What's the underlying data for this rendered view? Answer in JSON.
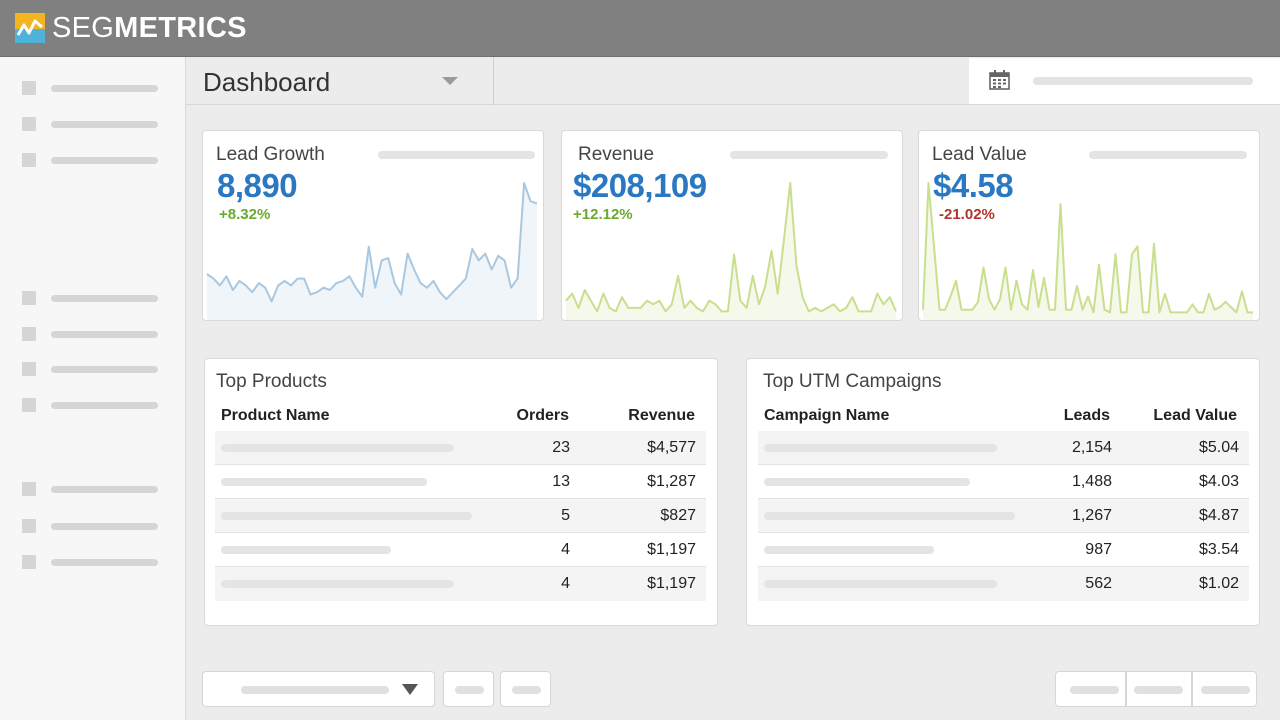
{
  "brand": {
    "name_light": "SEG",
    "name_bold": "METRICS",
    "colors": {
      "header": "#808080",
      "accent": "#2a78c2",
      "positive": "#6aaa2c",
      "negative": "#b5332e",
      "logo_yellow": "#f2b51f",
      "logo_blue": "#4fb3d9"
    }
  },
  "sidebar": {
    "icon": "placeholder-square-icon",
    "groups": [
      {
        "items": [
          {
            "label": ""
          },
          {
            "label": ""
          },
          {
            "label": ""
          }
        ]
      },
      {
        "items": [
          {
            "label": ""
          },
          {
            "label": ""
          },
          {
            "label": ""
          },
          {
            "label": ""
          }
        ]
      },
      {
        "items": [
          {
            "label": ""
          },
          {
            "label": ""
          },
          {
            "label": ""
          }
        ]
      }
    ]
  },
  "header": {
    "title": "Dashboard",
    "title_dropdown_icon": "caret-down-icon",
    "date_icon": "calendar-icon"
  },
  "metrics": [
    {
      "label": "Lead Growth",
      "value": "8,890",
      "change": "+8.32%",
      "trend": "positive",
      "chart_color": "#a9c8e0",
      "series": [
        18,
        16,
        13,
        17,
        11,
        15,
        13,
        10,
        14,
        12,
        6,
        13,
        15,
        13,
        16,
        16,
        9,
        10,
        12,
        11,
        14,
        15,
        17,
        12,
        8,
        30,
        12,
        24,
        25,
        14,
        9,
        27,
        20,
        14,
        12,
        15,
        10,
        7,
        10,
        13,
        16,
        29,
        24,
        27,
        20,
        26,
        24,
        12,
        16,
        58,
        50,
        49
      ]
    },
    {
      "label": "Revenue",
      "value": "$208,109",
      "change": "+12.12%",
      "trend": "positive",
      "chart_color": "#c8df8e",
      "series": [
        4,
        6,
        2,
        7,
        4,
        1,
        6,
        2,
        1,
        5,
        2,
        2,
        2,
        4,
        3,
        4,
        1,
        3,
        11,
        2,
        4,
        2,
        1,
        4,
        3,
        1,
        1,
        17,
        4,
        2,
        11,
        3,
        8,
        18,
        6,
        21,
        37,
        14,
        5,
        1,
        2,
        1,
        2,
        3,
        1,
        2,
        5,
        1,
        1,
        1,
        6,
        3,
        5,
        1
      ]
    },
    {
      "label": "Lead Value",
      "value": "$4.58",
      "change": "-21.02%",
      "trend": "negative",
      "chart_color": "#c8df8e",
      "series": [
        2,
        50,
        26,
        2,
        2,
        7,
        13,
        2,
        2,
        2,
        5,
        18,
        6,
        2,
        6,
        18,
        2,
        13,
        4,
        2,
        17,
        3,
        14,
        2,
        2,
        42,
        2,
        2,
        11,
        2,
        7,
        1,
        19,
        2,
        1,
        23,
        1,
        1,
        23,
        26,
        1,
        1,
        27,
        1,
        8,
        1,
        1,
        1,
        1,
        4,
        1,
        1,
        8,
        2,
        3,
        5,
        3,
        1,
        9,
        1,
        1
      ]
    }
  ],
  "top_products": {
    "title": "Top Products",
    "columns": [
      "Product Name",
      "Orders",
      "Revenue"
    ],
    "rows": [
      {
        "orders": "23",
        "revenue": "$4,577"
      },
      {
        "orders": "13",
        "revenue": "$1,287"
      },
      {
        "orders": "5",
        "revenue": "$827"
      },
      {
        "orders": "4",
        "revenue": "$1,197"
      },
      {
        "orders": "4",
        "revenue": "$1,197"
      }
    ]
  },
  "top_utm": {
    "title": "Top UTM Campaigns",
    "columns": [
      "Campaign Name",
      "Leads",
      "Lead Value"
    ],
    "rows": [
      {
        "leads": "2,154",
        "lead_value": "$5.04"
      },
      {
        "leads": "1,488",
        "lead_value": "$4.03"
      },
      {
        "leads": "1,267",
        "lead_value": "$4.87"
      },
      {
        "leads": "987",
        "lead_value": "$3.54"
      },
      {
        "leads": "562",
        "lead_value": "$1.02"
      }
    ]
  },
  "bottom_controls": {
    "dropdown_icon": "caret-down-icon"
  }
}
